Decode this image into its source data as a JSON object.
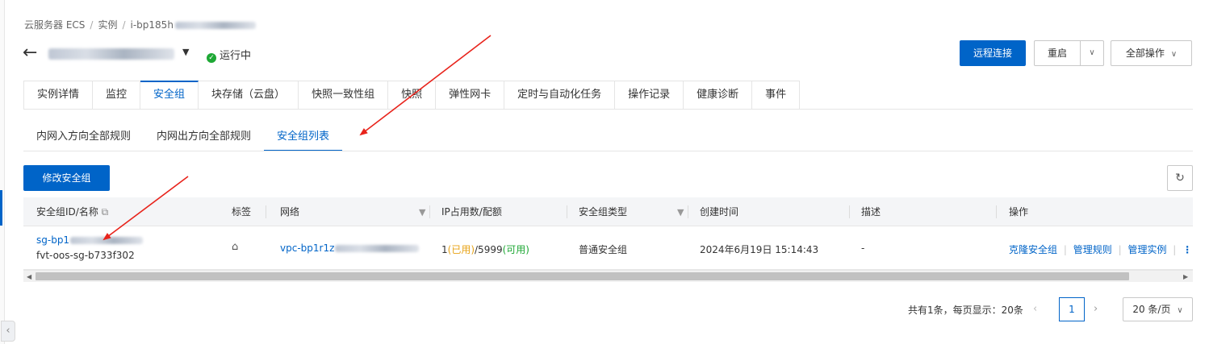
{
  "breadcrumb": {
    "items": [
      "云服务器 ECS",
      "实例",
      "i-bp185h"
    ],
    "separator": "/"
  },
  "title": {
    "back_icon": "arrow-left-icon",
    "dropdown_icon": "caret-down-icon",
    "status": "运行中",
    "status_color": "#1ea835"
  },
  "actions": {
    "remote": "远程连接",
    "restart": "重启",
    "all_ops": "全部操作",
    "chevron": "⌄"
  },
  "tabs": [
    "实例详情",
    "监控",
    "安全组",
    "块存储（云盘）",
    "快照一致性组",
    "快照",
    "弹性网卡",
    "定时与自动化任务",
    "操作记录",
    "健康诊断",
    "事件"
  ],
  "active_tab": "安全组",
  "subtabs": [
    "内网入方向全部规则",
    "内网出方向全部规则",
    "安全组列表"
  ],
  "active_subtab": "安全组列表",
  "toolbar": {
    "modify": "修改安全组",
    "refresh_icon": "refresh-icon"
  },
  "table": {
    "headers": {
      "id_name": "安全组ID/名称",
      "tags": "标签",
      "network": "网络",
      "ip_usage": "IP占用数/配额",
      "type": "安全组类型",
      "created": "创建时间",
      "desc": "描述",
      "ops": "操作"
    },
    "row": {
      "id": "sg-bp1",
      "name": "fvt-oos-sg-b733f302",
      "network": "vpc-bp1r1z",
      "ip_used": "1",
      "ip_used_label": "(已用)",
      "ip_quota": "/5999",
      "ip_avail_label": "(可用)",
      "type": "普通安全组",
      "created": "2024年6月19日 15:14:43",
      "desc": "-",
      "op_clone": "克隆安全组",
      "op_rules": "管理规则",
      "op_instances": "管理实例",
      "op_sep": "|"
    }
  },
  "pagination": {
    "total": "共有1条，每页显示：20条",
    "current": "1",
    "page_size": "20 条/页"
  },
  "colors": {
    "accent": "#0064c8",
    "used": "#e8a317",
    "available": "#1ea835",
    "annotation": "#e8231b"
  }
}
